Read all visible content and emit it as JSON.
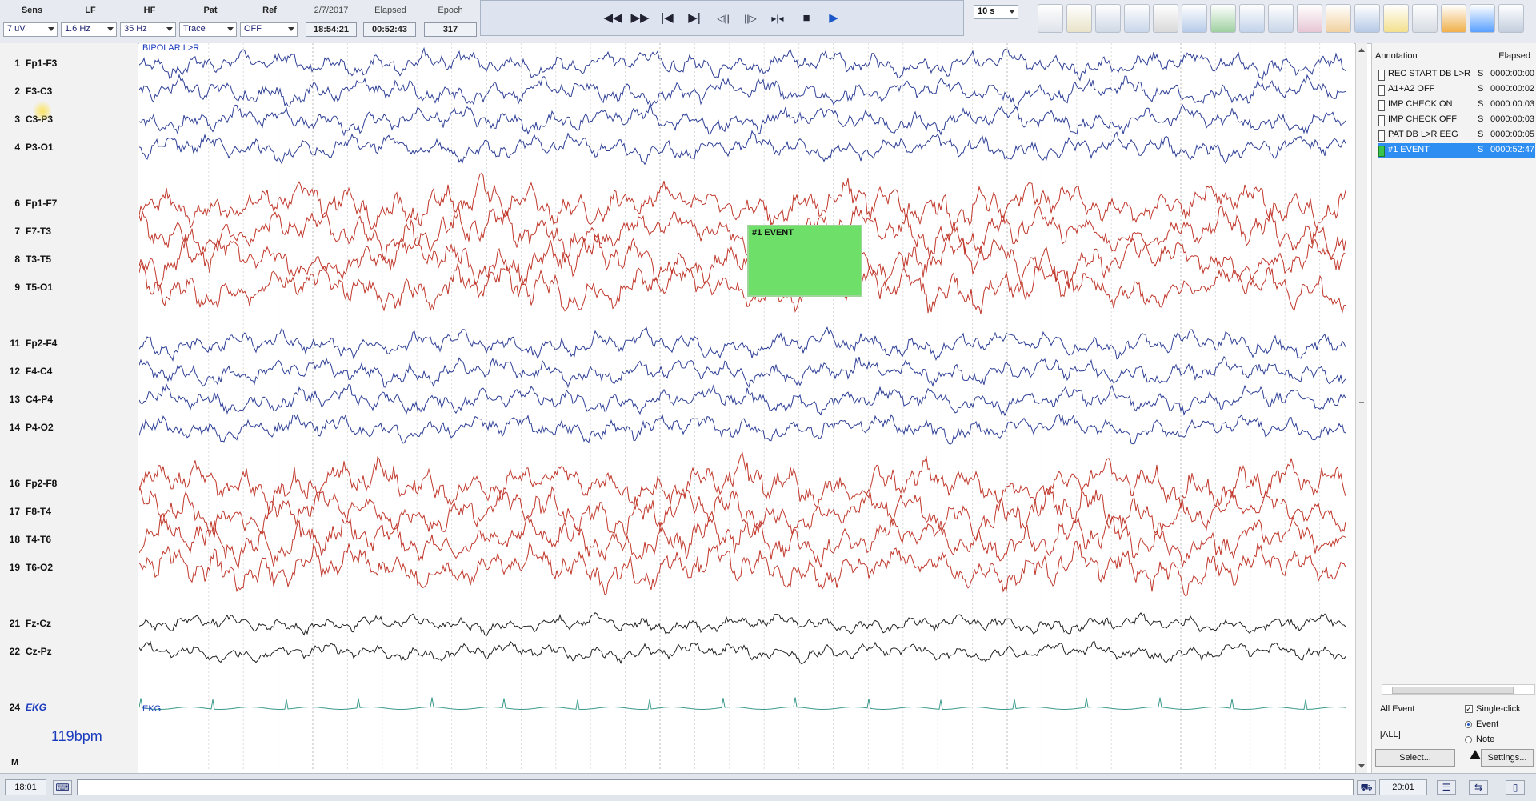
{
  "controls": {
    "sens": {
      "label": "Sens",
      "value": "7 uV"
    },
    "lf": {
      "label": "LF",
      "value": "1.6 Hz"
    },
    "hf": {
      "label": "HF",
      "value": "35 Hz"
    },
    "pat": {
      "label": "Pat",
      "value": "Trace"
    },
    "ref": {
      "label": "Ref",
      "value": "OFF"
    },
    "date": {
      "label": "2/7/2017",
      "value": "18:54:21"
    },
    "elapsed": {
      "label": "Elapsed",
      "value": "00:52:43"
    },
    "epoch": {
      "label": "Epoch",
      "value": "317"
    }
  },
  "transport": [
    {
      "name": "rewind",
      "glyph": "◀◀"
    },
    {
      "name": "fast-forward",
      "glyph": "▶▶"
    },
    {
      "name": "skip-start",
      "glyph": "|◀"
    },
    {
      "name": "skip-end",
      "glyph": "▶|"
    },
    {
      "name": "step-back",
      "glyph": "◁||"
    },
    {
      "name": "step-forward",
      "glyph": "||▷"
    },
    {
      "name": "collapse",
      "glyph": "▸|◂"
    },
    {
      "name": "stop",
      "glyph": "■"
    },
    {
      "name": "play",
      "glyph": "▶"
    }
  ],
  "timebase": {
    "value": "10 s"
  },
  "tool_colors": [
    "#dfe3ea",
    "#e9e3c9",
    "#cfd8e6",
    "#c9d6ea",
    "#d9d9d9",
    "#b7cce9",
    "#9fd0a0",
    "#c2d3ea",
    "#c8d6e8",
    "#e7c6d4",
    "#f2d2a0",
    "#b6c9e6",
    "#f3e08d",
    "#d6dbe3",
    "#f0b04b",
    "#5aa0ff",
    "#c3cede"
  ],
  "montage": "BIPOLAR L>R",
  "channels": [
    {
      "num": "1",
      "name": "Fp1-F3",
      "color": "#2e3f96"
    },
    {
      "num": "2",
      "name": "F3-C3",
      "color": "#2e3f96"
    },
    {
      "num": "3",
      "name": "C3-P3",
      "color": "#2e3f96"
    },
    {
      "num": "4",
      "name": "P3-O1",
      "color": "#2e3f96"
    },
    {
      "num": "6",
      "name": "Fp1-F7",
      "color": "#c0372b"
    },
    {
      "num": "7",
      "name": "F7-T3",
      "color": "#c0372b"
    },
    {
      "num": "8",
      "name": "T3-T5",
      "color": "#c0372b"
    },
    {
      "num": "9",
      "name": "T5-O1",
      "color": "#c0372b"
    },
    {
      "num": "11",
      "name": "Fp2-F4",
      "color": "#2e3f96"
    },
    {
      "num": "12",
      "name": "F4-C4",
      "color": "#2e3f96"
    },
    {
      "num": "13",
      "name": "C4-P4",
      "color": "#2e3f96"
    },
    {
      "num": "14",
      "name": "P4-O2",
      "color": "#2e3f96"
    },
    {
      "num": "16",
      "name": "Fp2-F8",
      "color": "#c0372b"
    },
    {
      "num": "17",
      "name": "F8-T4",
      "color": "#c0372b"
    },
    {
      "num": "18",
      "name": "T4-T6",
      "color": "#c0372b"
    },
    {
      "num": "19",
      "name": "T6-O2",
      "color": "#c0372b"
    },
    {
      "num": "21",
      "name": "Fz-Cz",
      "color": "#222222"
    },
    {
      "num": "22",
      "name": "Cz-Pz",
      "color": "#222222"
    },
    {
      "num": "24",
      "name": "EKG",
      "color": "#3a9a8a"
    }
  ],
  "ekg": {
    "label": "EKG",
    "bpm": "119bpm"
  },
  "m_label": "M",
  "event_marker": {
    "label": "#1 EVENT"
  },
  "annotations": {
    "header": {
      "col1": "Annotation",
      "col2": "Elapsed"
    },
    "rows": [
      {
        "text": "REC START DB L>R",
        "type": "S",
        "time": "0000:00:00"
      },
      {
        "text": "A1+A2 OFF",
        "type": "S",
        "time": "0000:00:02"
      },
      {
        "text": "IMP CHECK ON",
        "type": "S",
        "time": "0000:00:03"
      },
      {
        "text": "IMP CHECK OFF",
        "type": "S",
        "time": "0000:00:03"
      },
      {
        "text": "PAT DB L>R EEG",
        "type": "S",
        "time": "0000:00:05"
      },
      {
        "text": "#1 EVENT",
        "type": "S",
        "time": "0000:52:47",
        "selected": true
      }
    ],
    "filter": "All Event",
    "filter_value": "[ALL]",
    "single_click": "Single-click",
    "single_click_checked": true,
    "event_option": "Event",
    "note_option": "Note",
    "selected_option": "Event",
    "select_button": "Select...",
    "settings_button": "Settings..."
  },
  "status": {
    "time_left": "18:01",
    "command": "",
    "time_right": "20:01"
  }
}
